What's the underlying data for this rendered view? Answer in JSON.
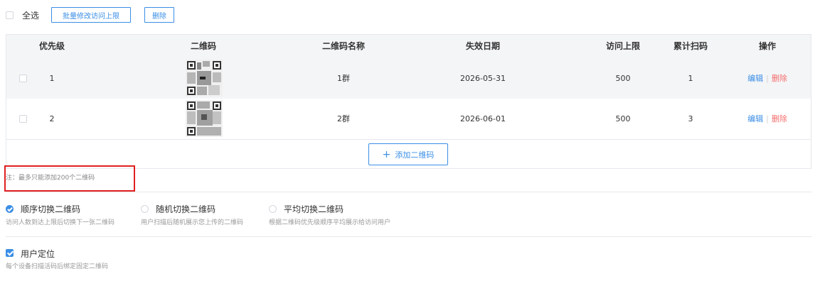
{
  "toolbar": {
    "select_all_label": "全选",
    "batch_edit_label": "批量修改访问上限",
    "delete_label": "删除"
  },
  "table": {
    "columns": [
      "优先级",
      "二维码",
      "二维码名称",
      "失效日期",
      "访问上限",
      "累计扫码",
      "操作"
    ],
    "rows": [
      {
        "priority": "1",
        "name": "1群",
        "expiry": "2026-05-31",
        "limit": "500",
        "scans": "1",
        "edit": "编辑",
        "delete": "删除"
      },
      {
        "priority": "2",
        "name": "2群",
        "expiry": "2026-06-01",
        "limit": "500",
        "scans": "3",
        "edit": "编辑",
        "delete": "删除"
      }
    ],
    "add_label": "添加二维码"
  },
  "note": "注：最多只能添加200个二维码",
  "modes": [
    {
      "label": "顺序切换二维码",
      "desc": "访问人数到达上限后切换下一张二维码",
      "selected": true
    },
    {
      "label": "随机切换二维码",
      "desc": "用户扫描后随机展示您上传的二维码",
      "selected": false
    },
    {
      "label": "平均切换二维码",
      "desc": "根据二维码优先级顺序平均展示给访问用户",
      "selected": false
    }
  ],
  "geo": {
    "label": "用户定位",
    "desc": "每个设备扫描活码后绑定固定二维码",
    "checked": true
  },
  "colors": {
    "accent": "#3a8ee6",
    "danger": "#f56c6c",
    "highlight_box": "#e02020"
  },
  "icons": [
    "checkbox-icon",
    "qr-code-icon",
    "plus-icon",
    "radio-icon"
  ]
}
